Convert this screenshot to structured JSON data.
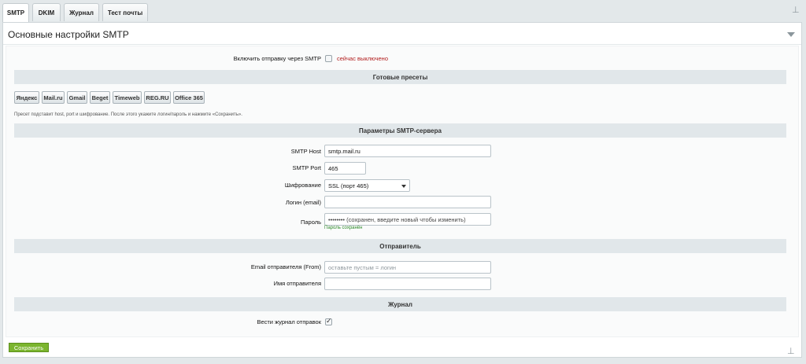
{
  "tabs": [
    {
      "label": "SMTP",
      "active": true
    },
    {
      "label": "DKIM",
      "active": false
    },
    {
      "label": "Журнал",
      "active": false
    },
    {
      "label": "Тест почты",
      "active": false
    }
  ],
  "panel": {
    "title": "Основные настройки SMTP"
  },
  "enable": {
    "label": "Включить отправку через SMTP",
    "checked": false,
    "status": "сейчас выключено"
  },
  "sections": {
    "presets": "Готовые пресеты",
    "server": "Параметры SMTP-сервера",
    "sender": "Отправитель",
    "journal": "Журнал"
  },
  "presets": [
    "Яндекс",
    "Mail.ru",
    "Gmail",
    "Beget",
    "Timeweb",
    "REG.RU",
    "Office 365"
  ],
  "preset_hint": "Пресет подставит host, port и шифрование. После этого укажите логин/пароль и нажмите «Сохранить».",
  "server": {
    "host_label": "SMTP Host",
    "host_value": "smtp.mail.ru",
    "port_label": "SMTP Port",
    "port_value": "465",
    "encryption_label": "Шифрование",
    "encryption_value": "SSL (порт 465)",
    "login_label": "Логин (email)",
    "login_value": "",
    "password_label": "Пароль",
    "password_value": "••••••••  (сохранен, введите новый чтобы изменить)",
    "password_saved": "Пароль сохранён"
  },
  "sender": {
    "from_label": "Email отправителя (From)",
    "from_placeholder": "оставьте пустым = логин",
    "name_label": "Имя отправителя",
    "name_value": ""
  },
  "journal": {
    "label": "Вести журнал отправок",
    "checked": true
  },
  "save_label": "Сохранить",
  "colors": {
    "accent": "#7bb52e",
    "status_off": "#b11b1b",
    "saved": "#2f8a2a"
  }
}
